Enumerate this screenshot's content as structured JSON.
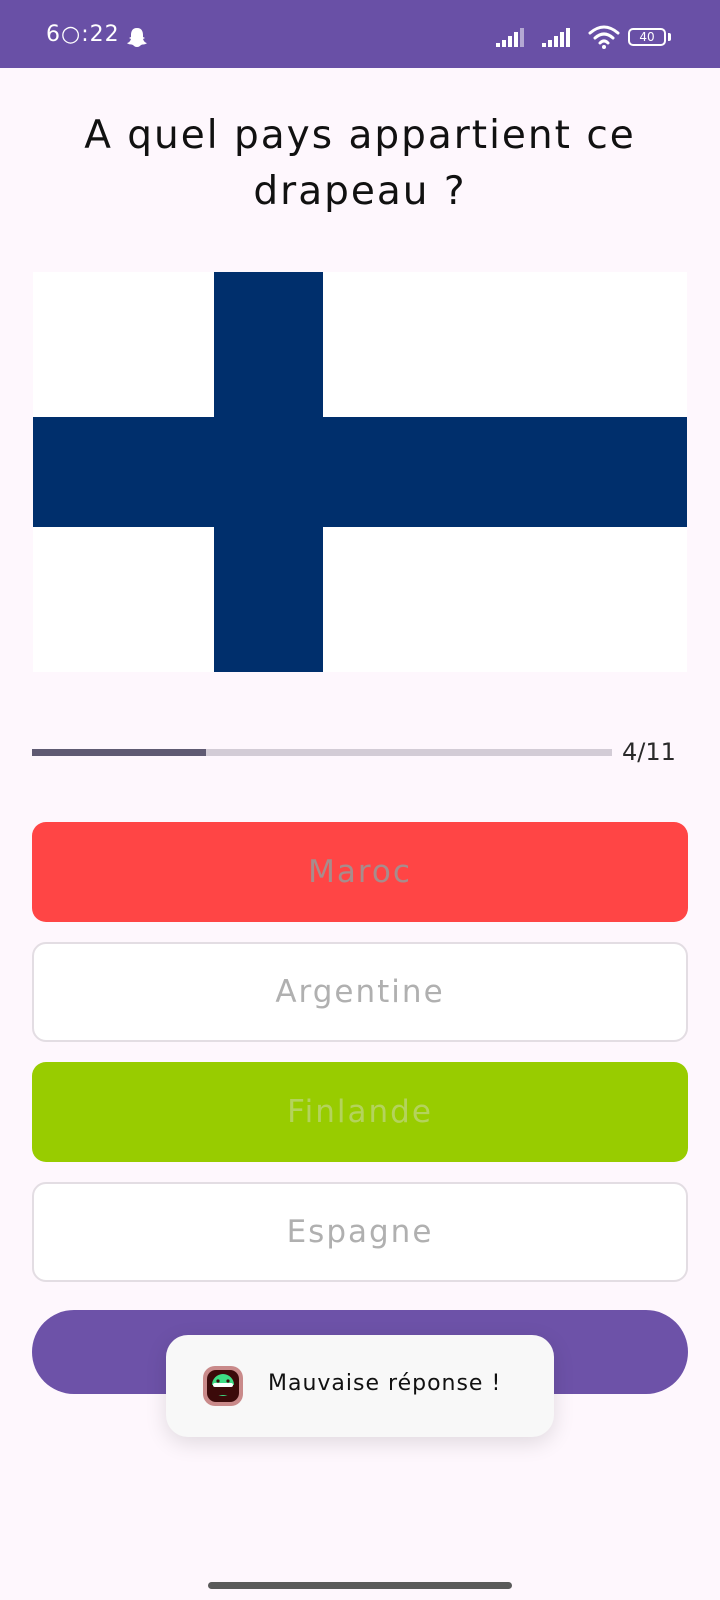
{
  "status_bar": {
    "time": "6○:22",
    "battery": "40",
    "background": "#6950a6"
  },
  "quiz": {
    "question": "A quel pays appartient ce drapeau ?",
    "flag": {
      "icon": "flag-finland-icon",
      "background": "#ffffff",
      "cross_color": "#002f6c"
    },
    "progress": {
      "label": "4/11",
      "fraction": 0.3
    },
    "answers": [
      {
        "label": "Maroc",
        "state": "wrong",
        "background": "#ff4545",
        "text_color": "#a88c8c"
      },
      {
        "label": "Argentine",
        "state": "neutral",
        "background": "#ffffff",
        "text_color": "#b0b0b0"
      },
      {
        "label": "Finlande",
        "state": "correct",
        "background": "#98cc00",
        "text_color": "#b4d35c"
      },
      {
        "label": "Espagne",
        "state": "neutral",
        "background": "#ffffff",
        "text_color": "#b0b0b0"
      }
    ],
    "next_button": {
      "background": "#6d52a8"
    }
  },
  "toast": {
    "icon": "app-icon",
    "message": "Mauvaise réponse !"
  }
}
